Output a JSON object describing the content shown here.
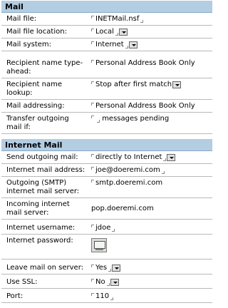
{
  "mail": {
    "title": "Mail",
    "rows": [
      {
        "label": "Mail file:",
        "value": "INETMail.nsf"
      },
      {
        "label": "Mail file location:",
        "value": "Local"
      },
      {
        "label": "Mail system:",
        "value": "Internet"
      },
      {
        "label": "Recipient name type-ahead:",
        "value": "Personal Address Book Only"
      },
      {
        "label": "Recipient name lookup:",
        "value": "Stop after first match"
      },
      {
        "label": "Mail addressing:",
        "value": "Personal Address Book Only"
      },
      {
        "label": "Transfer outgoing mail if:",
        "value": "messages pending"
      }
    ]
  },
  "internet_mail": {
    "title": "Internet Mail",
    "rows": [
      {
        "label": "Send outgoing mail:",
        "value": "directly to Internet"
      },
      {
        "label": "Internet mail address:",
        "value": "joe@doeremi.com"
      },
      {
        "label": "Outgoing (SMTP) internet mail server:",
        "value": "smtp.doeremi.com"
      },
      {
        "label": "Incoming internet mail server:",
        "value": "pop.doeremi.com"
      },
      {
        "label": "Internet username:",
        "value": "jdoe"
      },
      {
        "label": "Internet password:",
        "value": ""
      },
      {
        "label": "Leave mail on server:",
        "value": "Yes"
      },
      {
        "label": "Use SSL:",
        "value": "No"
      },
      {
        "label": "Port:",
        "value": "110"
      }
    ]
  },
  "icons": [
    "field-bracket-icon",
    "dropdown-arrow-icon",
    "password-key-icon"
  ]
}
